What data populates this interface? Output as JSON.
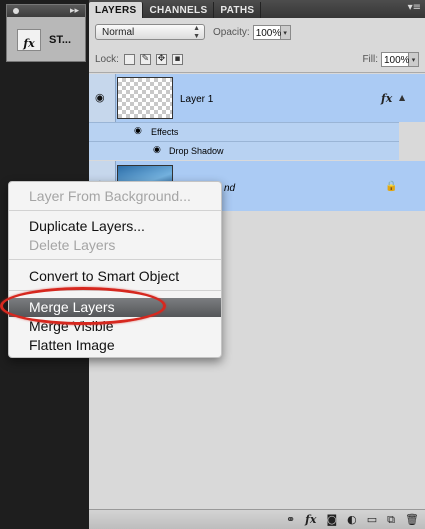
{
  "styles_panel": {
    "item_label": "ST...",
    "fx_icon": "fx-icon"
  },
  "tabs": [
    "LAYERS",
    "CHANNELS",
    "PATHS"
  ],
  "options": {
    "blend_mode": "Normal",
    "opacity_label": "Opacity:",
    "opacity_value": "100%",
    "lock_label": "Lock:",
    "fill_label": "Fill:",
    "fill_value": "100%"
  },
  "layers": [
    {
      "name": "Layer 1",
      "effects_label": "Effects",
      "effect": "Drop Shadow"
    },
    {
      "name": "Background",
      "visible_name_fragment": "nd"
    }
  ],
  "context_menu": {
    "items": [
      {
        "label": "Layer From Background...",
        "enabled": false
      },
      {
        "label": "Duplicate Layers...",
        "enabled": true
      },
      {
        "label": "Delete Layers",
        "enabled": false
      },
      {
        "label": "Convert to Smart Object",
        "enabled": true
      },
      {
        "label": "Merge Layers",
        "enabled": true,
        "highlighted": true
      },
      {
        "label": "Merge Visible",
        "enabled": true
      },
      {
        "label": "Flatten Image",
        "enabled": true
      }
    ]
  },
  "bottom_toolbar_icons": [
    "link-icon",
    "fx-icon",
    "mask-icon",
    "adjustment-icon",
    "folder-icon",
    "new-layer-icon",
    "trash-icon"
  ],
  "colors": {
    "selected_layer": "#abcbf4",
    "highlight": "#5e6063",
    "annotation_ring": "#d6281f"
  }
}
